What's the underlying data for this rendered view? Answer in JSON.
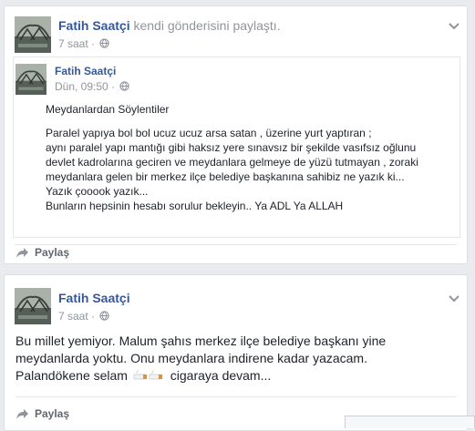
{
  "post1": {
    "author": "Fatih Saatçi",
    "action": "kendi gönderisini paylaştı.",
    "time": "7 saat",
    "inner": {
      "author": "Fatih Saatçi",
      "time": "Dün, 09:50",
      "title": "Meydanlardan Söylentiler",
      "lines": [
        "Paralel yapıya bol bol ucuz ucuz arsa satan , üzerine yurt yaptıran ;",
        "aynı paralel yapı mantığı gibi haksız yere sınavsız bir şekilde vasıfsız oğlunu",
        "devlet kadrolarına geciren ve meydanlara gelmeye de yüzü tutmayan , zoraki",
        "meydanlara gelen bir merkez ilçe belediye başkanına sahibiz ne yazık ki...",
        "Yazık çooook yazık...",
        "Bunların hepsinin hesabı sorulur bekleyin.. Ya ADL Ya ALLAH"
      ]
    },
    "share_label": "Paylaş"
  },
  "post2": {
    "author": "Fatih Saatçi",
    "time": "7 saat",
    "lines": [
      "Bu millet yemiyor. Malum şahıs merkez ilçe belediye başkanı yine",
      "meydanlarda yoktu. Onu meydanlara indirene kadar yazacam.",
      "Palandökene selam",
      "cigaraya devam..."
    ],
    "share_label": "Paylaş"
  },
  "icons": {
    "globe": "globe-icon",
    "chevron": "chevron-down-icon",
    "share": "share-arrow-icon",
    "sticker": "cigarette-emoji-icon"
  },
  "colors": {
    "link": "#365899",
    "meta": "#90949c",
    "background": "#e9ebee"
  }
}
